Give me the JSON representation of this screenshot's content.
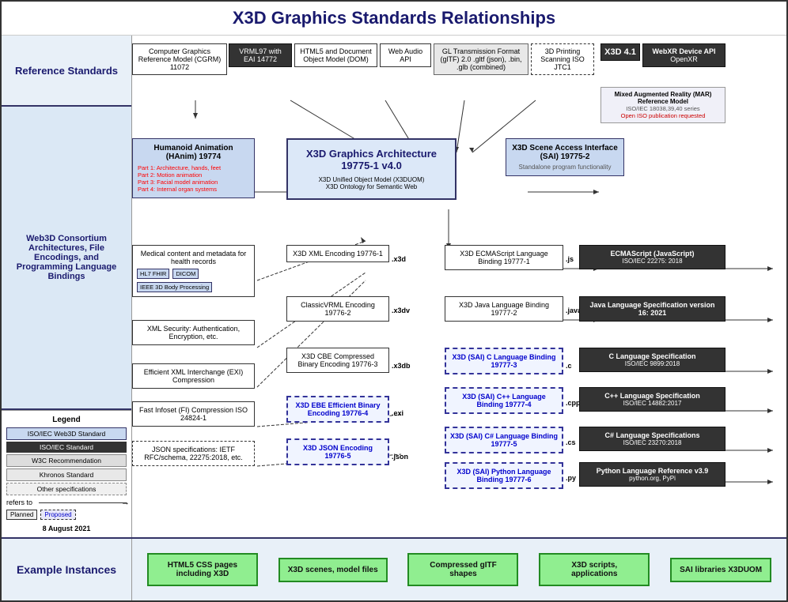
{
  "title": "X3D Graphics Standards Relationships",
  "sidebar": {
    "ref_standards": "Reference Standards",
    "web3d_section": "Web3D Consortium Architectures, File Encodings, and Programming Language Bindings",
    "legend_title": "Legend",
    "legend_items": [
      {
        "label": "ISO/IEC Web3D Standard",
        "type": "iso-web"
      },
      {
        "label": "ISO/IEC Standard",
        "type": "iso"
      },
      {
        "label": "W3C Recommendation",
        "type": "w3c"
      },
      {
        "label": "Khronos Standard",
        "type": "khronos"
      },
      {
        "label": "Other specifications",
        "type": "other"
      }
    ],
    "refers_to": "refers to",
    "planned": "Planned",
    "proposed": "Proposed",
    "date": "8 August 2021"
  },
  "top_standards": [
    {
      "label": "Computer Graphics Reference Model (CGRM) 11072",
      "type": "white"
    },
    {
      "label": "VRML97 with EAI 14772",
      "type": "white"
    },
    {
      "label": "HTML5 and Document Object Model (DOM)",
      "type": "white"
    },
    {
      "label": "Web Audio API",
      "type": "white"
    },
    {
      "label": "GL Transmission Format (glTF) 2.0 .gltf (json), .bin, .glb (combined)",
      "type": "white"
    },
    {
      "label": "3D Printing Scanning ISO JTC1",
      "type": "white"
    }
  ],
  "x3d_main": {
    "label": "X3D Graphics Architecture 19775-1 v4.0",
    "sub1": "X3D Unified Object Model (X3DUOM)",
    "sub2": "X3D Ontology for Semantic Web"
  },
  "x3d_41": {
    "label": "X3D 4.1"
  },
  "webxr": {
    "label": "WebXR Device API",
    "sub": "OpenXR"
  },
  "mar": {
    "label": "Mixed Augmented Reality (MAR) Reference Model",
    "sub1": "ISO/IEC 18038,39,40 series",
    "sub2": "Open ISO publication requested"
  },
  "hanim": {
    "label": "Humanoid Animation (HAnim) 19774",
    "parts": [
      "Part 1: Architecture, hands, feet",
      "Part 2: Motion animation",
      "Part 3: Facial model animation",
      "Part 4: Internal organ systems"
    ]
  },
  "sai": {
    "label": "X3D Scene Access Interface (SAI) 19775-2",
    "sub": "Standalone program functionality"
  },
  "medical": {
    "label": "Medical content and metadata for health records",
    "refs": [
      "HL7 FHIR",
      "DICOM",
      "IEEE 3D Body Processing"
    ]
  },
  "xml_security": {
    "label": "XML Security: Authentication, Encryption, etc."
  },
  "exi": {
    "label": "Efficient XML Interchange (EXI) Compression"
  },
  "fast_infoset": {
    "label": "Fast Infoset (FI) Compression ISO 24824-1"
  },
  "json_spec": {
    "label": "JSON specifications: IETF RFC/schema, 22275:2018, etc."
  },
  "encodings": [
    {
      "label": "X3D XML Encoding 19776-1",
      "ext": ".x3d"
    },
    {
      "label": "ClassicVRML Encoding 19776-2",
      "ext": ".x3dv"
    },
    {
      "label": "X3D CBE Compressed Binary Encoding 19776-3",
      "ext": ".x3db"
    },
    {
      "label": "X3D EBE Efficient Binary Encoding 19776-4",
      "ext": ".exi",
      "proposed": true
    },
    {
      "label": "X3D JSON Encoding 19776-5",
      "ext": ".json",
      "proposed": true
    }
  ],
  "ecmascript_binding": {
    "label": "X3D ECMAScript Language Binding 19777-1",
    "ext": ".js"
  },
  "java_binding": {
    "label": "X3D Java Language Binding 19777-2",
    "ext": ".java .jar"
  },
  "c_binding": {
    "label": "X3D (SAI) C Language Binding 19777-3",
    "ext": ".c",
    "proposed": true
  },
  "cpp_binding": {
    "label": "X3D (SAI) C++ Language Binding 19777-4",
    "ext": ".cpp",
    "proposed": true
  },
  "cs_binding": {
    "label": "X3D (SAI) C# Language Binding 19777-5",
    "ext": ".cs",
    "proposed": true
  },
  "python_binding": {
    "label": "X3D (SAI) Python Language Binding 19777-6",
    "ext": ".py",
    "proposed": true
  },
  "ecmascript_std": {
    "label": "ECMAScript (JavaScript)",
    "sub": "ISO/IEC 22275: 2018"
  },
  "java_std": {
    "label": "Java Language Specification version 16: 2021"
  },
  "c_std": {
    "label": "C Language Specification",
    "sub": "ISO/IEC 9899:2018"
  },
  "cpp_std": {
    "label": "C++ Language Specification",
    "sub": "ISO/IEC 14882:2017"
  },
  "cs_std": {
    "label": "C# Language Specifications",
    "sub": "ISO/IEC 23270:2018"
  },
  "python_std": {
    "label": "Python Language Reference v3.9",
    "sub": "python.org, PyPi"
  },
  "bottom": {
    "label": "Example\nInstances",
    "items": [
      {
        "label": "HTML5 CSS pages including X3D"
      },
      {
        "label": "X3D scenes, model files"
      },
      {
        "label": "Compressed gITF shapes"
      },
      {
        "label": "X3D scripts, applications"
      },
      {
        "label": "SAI libraries X3DUOM"
      }
    ]
  }
}
